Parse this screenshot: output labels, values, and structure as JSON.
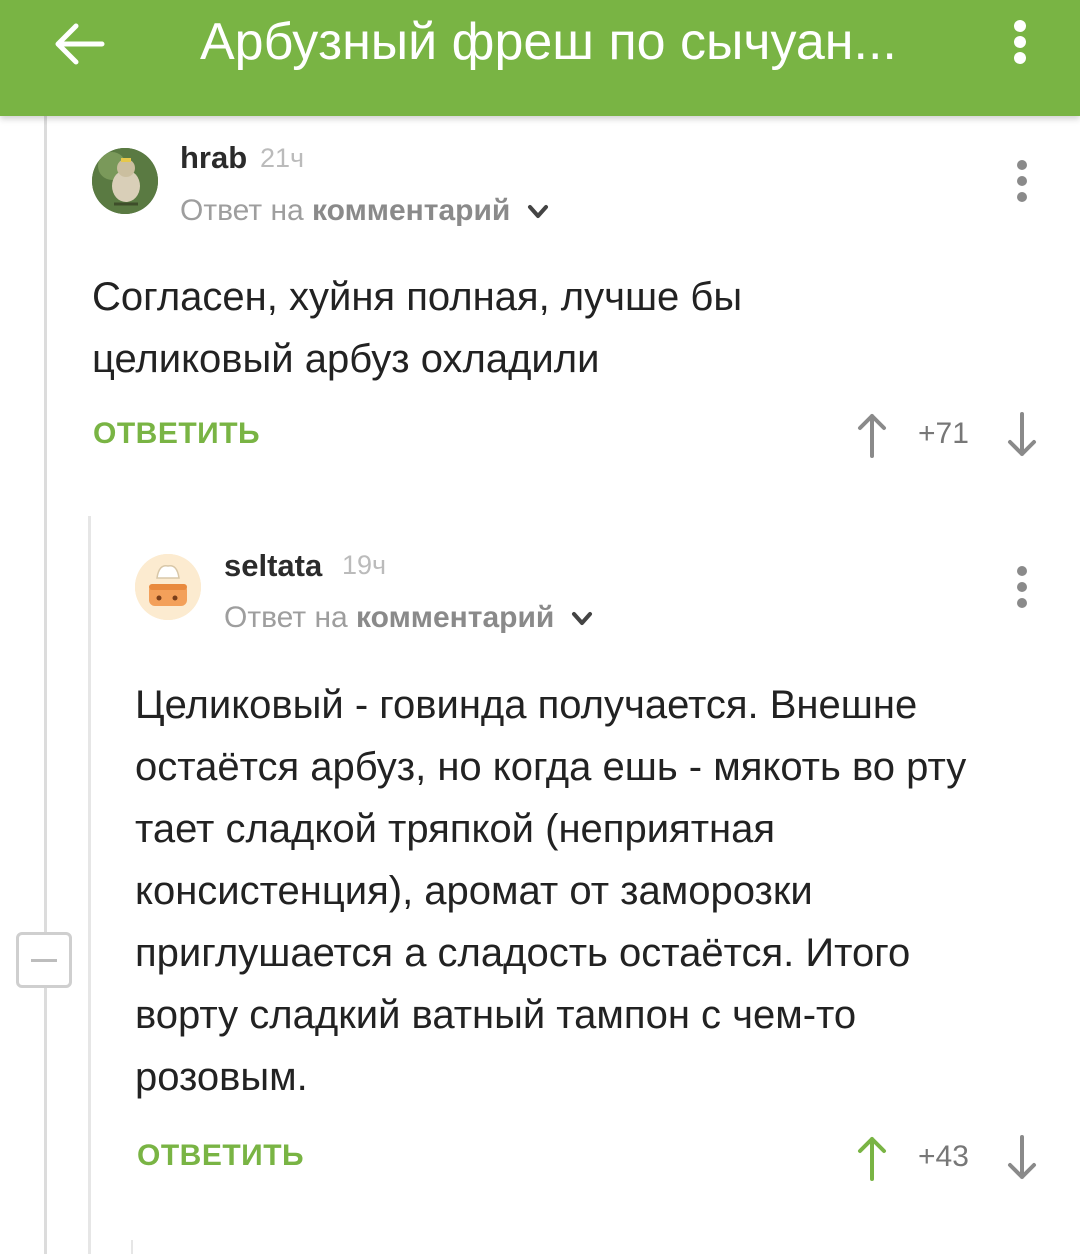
{
  "colors": {
    "accent": "#79b444",
    "muted": "#9e9e9e",
    "active_vote": "#79b444"
  },
  "header": {
    "title": "Арбузный фреш по сычуан...",
    "back_icon": "arrow-left-icon",
    "menu_icon": "more-vertical-icon"
  },
  "comments": [
    {
      "author": "hrab",
      "time": "21ч",
      "reply_prefix": "Ответ на",
      "reply_link": "комментарий",
      "text": "Согласен, хуйня полная, лучше бы целиковый арбуз охладили",
      "reply_label": "ОТВЕТИТЬ",
      "score": "+71",
      "upvoted": false
    },
    {
      "author": "seltata",
      "time": "19ч",
      "reply_prefix": "Ответ на",
      "reply_link": "комментарий",
      "text": "Целиковый - говинда получается. Внешне остаётся арбуз, но когда ешь - мякоть во рту тает сладкой тряпкой (неприятная консистенция), аромат от заморозки приглушается а сладость остаётся. Итого ворту сладкий ватный тампон с чем-то розовым.",
      "reply_label": "ОТВЕТИТЬ",
      "score": "+43",
      "upvoted": true
    }
  ]
}
